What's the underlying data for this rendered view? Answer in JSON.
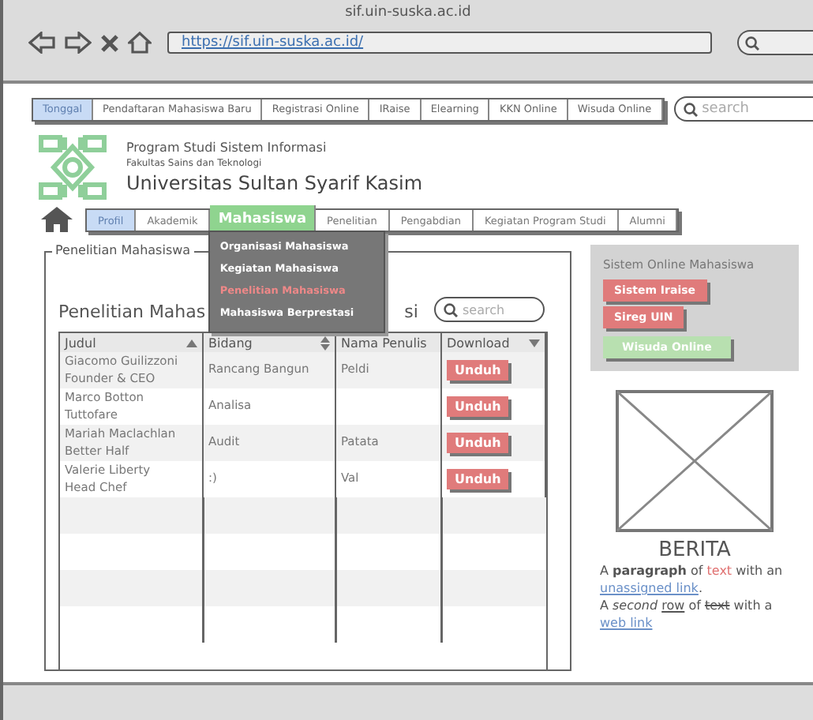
{
  "window": {
    "title": "sif.uin-suska.ac.id",
    "url": "https://sif.uin-suska.ac.id/"
  },
  "top_tabs": [
    {
      "label": "Tonggal",
      "selected": true
    },
    {
      "label": "Pendaftaran Mahasiswa Baru",
      "selected": false
    },
    {
      "label": "Registrasi Online",
      "selected": false
    },
    {
      "label": "IRaise",
      "selected": false
    },
    {
      "label": "Elearning",
      "selected": false
    },
    {
      "label": "KKN Online",
      "selected": false
    },
    {
      "label": "Wisuda Online",
      "selected": false
    }
  ],
  "top_search": {
    "placeholder": "search"
  },
  "header": {
    "program": "Program Studi Sistem Informasi",
    "faculty": "Fakultas Sains dan Teknologi",
    "university": "Universitas Sultan Syarif Kasim"
  },
  "menu": [
    {
      "label": "Profil",
      "selected": true,
      "expanded": false
    },
    {
      "label": "Akademik",
      "selected": false,
      "expanded": false
    },
    {
      "label": "Mahasiswa",
      "selected": false,
      "expanded": true
    },
    {
      "label": "Penelitian",
      "selected": false,
      "expanded": false
    },
    {
      "label": "Pengabdian",
      "selected": false,
      "expanded": false
    },
    {
      "label": "Kegiatan Program Studi",
      "selected": false,
      "expanded": false
    },
    {
      "label": "Alumni",
      "selected": false,
      "expanded": false
    }
  ],
  "dropdown": [
    {
      "label": "Organisasi Mahasiswa",
      "selected": false
    },
    {
      "label": "Kegiatan Mahasiswa",
      "selected": false
    },
    {
      "label": "Penelitian Mahasiswa",
      "selected": true
    },
    {
      "label": "Mahasiswa Berprestasi",
      "selected": false
    }
  ],
  "panel": {
    "legend": "Penelitian Mahasiswa",
    "heading_left": "Penelitian Mahas",
    "heading_right": "si",
    "search": {
      "placeholder": "search"
    }
  },
  "table": {
    "columns": [
      {
        "label": "Judul",
        "kind": "ascending"
      },
      {
        "label": "Bidang",
        "kind": "sortable"
      },
      {
        "label": "Nama Penulis",
        "kind": "plain"
      },
      {
        "label": "Download",
        "kind": "descending"
      }
    ],
    "rows": [
      {
        "judul": "Giacomo Guilizzoni\nFounder & CEO",
        "bidang": "Rancang Bangun",
        "penulis": "Peldi",
        "download": "Unduh"
      },
      {
        "judul": "Marco Botton\nTuttofare",
        "bidang": "Analisa",
        "download": "Unduh"
      },
      {
        "judul": "Mariah Maclachlan\nBetter Half",
        "bidang": "Audit",
        "penulis": "Patata",
        "download": "Unduh"
      },
      {
        "judul": "Valerie Liberty\nHead Chef",
        "bidang": ":)",
        "penulis": "Val",
        "download": "Unduh"
      }
    ]
  },
  "sidebar": {
    "title": "Sistem Online Mahasiswa",
    "buttons": [
      {
        "label": "Sistem Iraise",
        "kind": "danger"
      },
      {
        "label": "Sireg UIN",
        "kind": "danger"
      },
      {
        "label": "Wisuda Online",
        "kind": "success"
      }
    ]
  },
  "news": {
    "title": "BERITA",
    "lines": [
      [
        {
          "kind": "text",
          "text": "A **paragraph** of "
        },
        {
          "kind": "highlight",
          "text": "text"
        },
        {
          "kind": "text",
          "text": " with an "
        },
        {
          "kind": "link",
          "text": "unassigned link"
        },
        {
          "kind": "text",
          "text": "."
        }
      ],
      [
        {
          "kind": "text",
          "text": "A *second* "
        },
        {
          "kind": "underline",
          "text": "row"
        },
        {
          "kind": "text",
          "text": " of "
        },
        {
          "kind": "strike",
          "text": "text"
        },
        {
          "kind": "text",
          "text": " with a "
        },
        {
          "kind": "link",
          "text": "web link"
        }
      ]
    ]
  }
}
